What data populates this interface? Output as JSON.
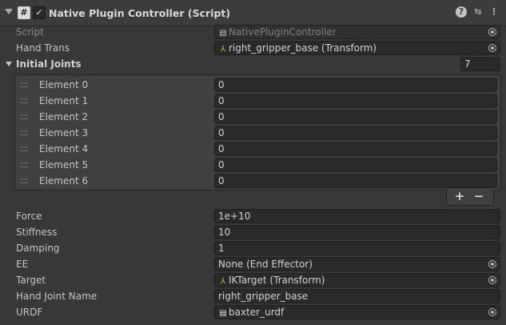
{
  "component": {
    "title": "Native Plugin Controller (Script)",
    "script_icon": "#",
    "enabled_check": "✓",
    "icons": {
      "help": "?",
      "preset": "⇆",
      "menu": "⋮"
    }
  },
  "fields": {
    "script": {
      "label": "Script",
      "value": "NativePluginController"
    },
    "hand_trans": {
      "label": "Hand Trans",
      "value": "right_gripper_base (Transform)"
    },
    "initial_joints": {
      "label": "Initial Joints",
      "size": "7",
      "elements": [
        {
          "label": "Element 0",
          "value": "0"
        },
        {
          "label": "Element 1",
          "value": "0"
        },
        {
          "label": "Element 2",
          "value": "0"
        },
        {
          "label": "Element 3",
          "value": "0"
        },
        {
          "label": "Element 4",
          "value": "0"
        },
        {
          "label": "Element 5",
          "value": "0"
        },
        {
          "label": "Element 6",
          "value": "0"
        }
      ],
      "add_label": "+",
      "remove_label": "−"
    },
    "force": {
      "label": "Force",
      "value": "1e+10"
    },
    "stiffness": {
      "label": "Stiffness",
      "value": "10"
    },
    "damping": {
      "label": "Damping",
      "value": "1"
    },
    "ee": {
      "label": "EE",
      "value": "None (End Effector)"
    },
    "target": {
      "label": "Target",
      "value": "IKTarget (Transform)"
    },
    "hand_joint_name": {
      "label": "Hand Joint Name",
      "value": "right_gripper_base"
    },
    "urdf": {
      "label": "URDF",
      "value": "baxter_urdf"
    }
  }
}
